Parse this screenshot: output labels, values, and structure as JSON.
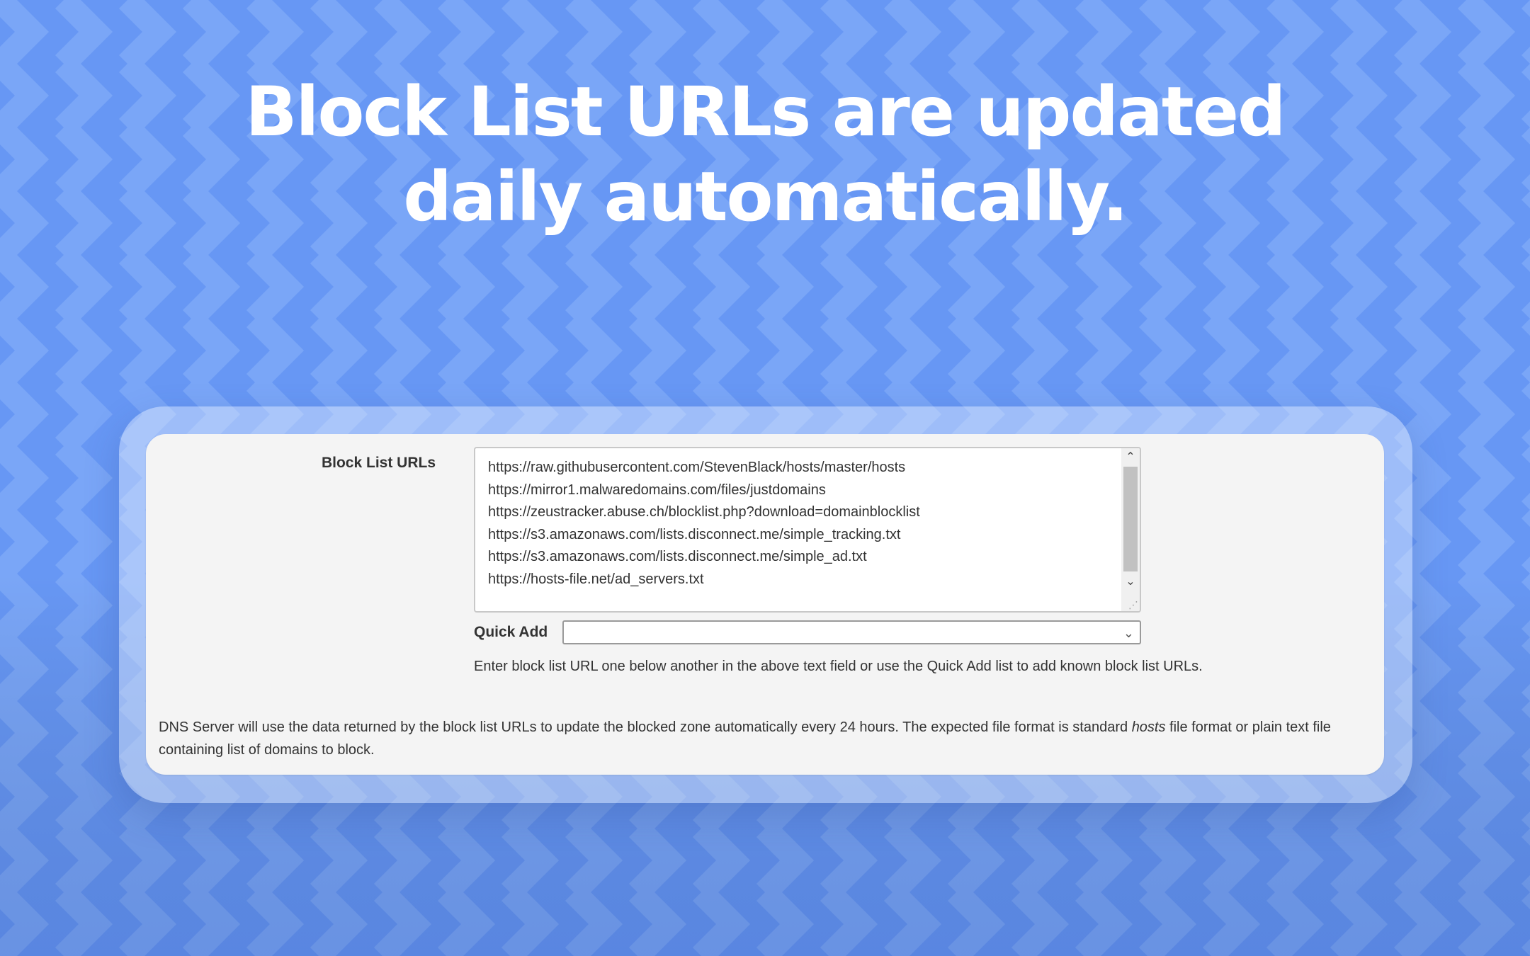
{
  "colors": {
    "background": "#6b99f5",
    "headline_text": "#ffffff",
    "panel": "#f4f4f4",
    "text": "#333333"
  },
  "headline": {
    "line1": "Block List URLs are updated",
    "line2": "daily automatically."
  },
  "form": {
    "block_list_label": "Block List URLs",
    "urls": [
      "https://raw.githubusercontent.com/StevenBlack/hosts/master/hosts",
      "https://mirror1.malwaredomains.com/files/justdomains",
      "https://zeustracker.abuse.ch/blocklist.php?download=domainblocklist",
      "https://s3.amazonaws.com/lists.disconnect.me/simple_tracking.txt",
      "https://s3.amazonaws.com/lists.disconnect.me/simple_ad.txt",
      "https://hosts-file.net/ad_servers.txt"
    ],
    "quick_add_label": "Quick Add",
    "quick_add_value": "",
    "help_text": "Enter block list URL one below another in the above text field or use the Quick Add list to add known block list URLs.",
    "description_before": "DNS Server will use the data returned by the block list URLs to update the blocked zone automatically every 24 hours. The expected file format is standard ",
    "description_emphasis": "hosts",
    "description_after": " file format or plain text file containing list of domains to block."
  },
  "icons": {
    "scroll_up": "chevron-up-icon",
    "scroll_down": "chevron-down-icon",
    "select_arrow": "chevron-down-icon",
    "resize": "resize-grip-icon"
  }
}
